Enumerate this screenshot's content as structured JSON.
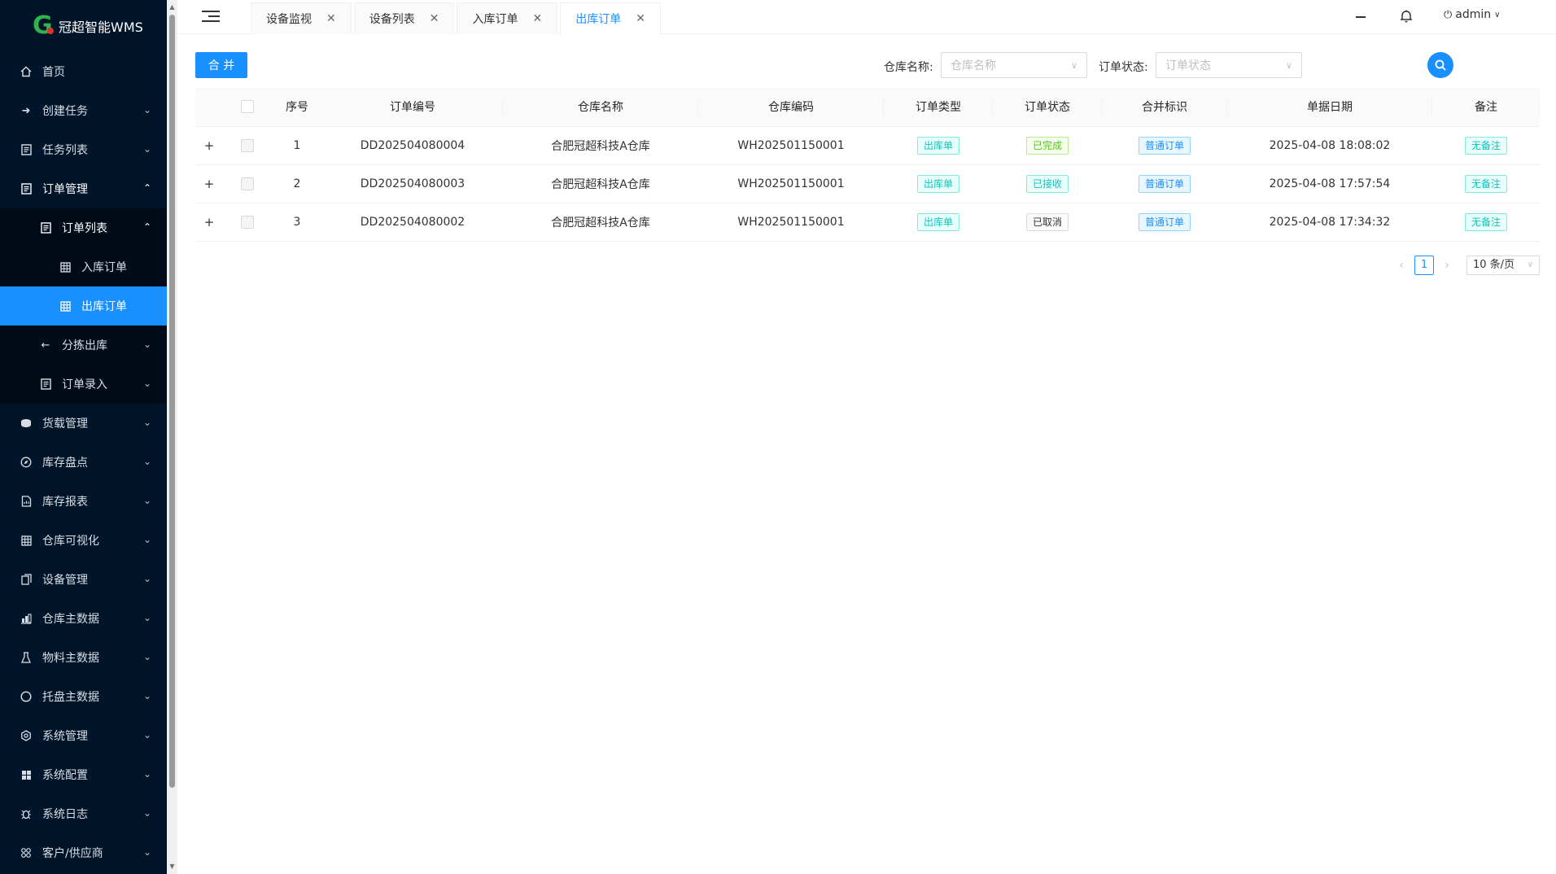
{
  "app": {
    "title": "冠超智能WMS"
  },
  "sidebar": {
    "items": [
      {
        "label": "首页",
        "icon": "home-icon"
      },
      {
        "label": "创建任务",
        "icon": "arrow-right-icon"
      },
      {
        "label": "任务列表",
        "icon": "list-icon"
      },
      {
        "label": "订单管理",
        "icon": "document-icon"
      },
      {
        "label": "订单列表",
        "icon": "document-icon"
      },
      {
        "label": "入库订单",
        "icon": "table-icon"
      },
      {
        "label": "出库订单",
        "icon": "table-icon"
      },
      {
        "label": "分拣出库",
        "icon": "arrow-left-icon"
      },
      {
        "label": "订单录入",
        "icon": "document-icon"
      },
      {
        "label": "货载管理",
        "icon": "database-icon"
      },
      {
        "label": "库存盘点",
        "icon": "compass-icon"
      },
      {
        "label": "库存报表",
        "icon": "report-icon"
      },
      {
        "label": "仓库可视化",
        "icon": "grid-icon"
      },
      {
        "label": "设备管理",
        "icon": "copy-icon"
      },
      {
        "label": "仓库主数据",
        "icon": "bar-chart-icon"
      },
      {
        "label": "物料主数据",
        "icon": "flask-icon"
      },
      {
        "label": "托盘主数据",
        "icon": "circle-icon"
      },
      {
        "label": "系统管理",
        "icon": "gear-icon"
      },
      {
        "label": "系统配置",
        "icon": "appstore-icon"
      },
      {
        "label": "系统日志",
        "icon": "bug-icon"
      },
      {
        "label": "客户/供应商",
        "icon": "team-icon"
      }
    ]
  },
  "header": {
    "tabs": [
      {
        "label": "设备监视"
      },
      {
        "label": "设备列表"
      },
      {
        "label": "入库订单"
      },
      {
        "label": "出库订单"
      }
    ],
    "user": "admin"
  },
  "toolbar": {
    "merge_label": "合 并",
    "warehouse_label": "仓库名称:",
    "warehouse_placeholder": "仓库名称",
    "status_label": "订单状态:",
    "status_placeholder": "订单状态"
  },
  "table": {
    "columns": [
      "序号",
      "订单编号",
      "仓库名称",
      "仓库编码",
      "订单类型",
      "订单状态",
      "合并标识",
      "单据日期",
      "备注"
    ],
    "rows": [
      {
        "no": "1",
        "order_no": "DD202504080004",
        "warehouse": "合肥冠超科技A仓库",
        "code": "WH202501150001",
        "type": "出库单",
        "status": "已完成",
        "status_color": "green",
        "merge": "普通订单",
        "date": "2025-04-08 18:08:02",
        "remark": "无备注"
      },
      {
        "no": "2",
        "order_no": "DD202504080003",
        "warehouse": "合肥冠超科技A仓库",
        "code": "WH202501150001",
        "type": "出库单",
        "status": "已接收",
        "status_color": "cyan",
        "merge": "普通订单",
        "date": "2025-04-08 17:57:54",
        "remark": "无备注"
      },
      {
        "no": "3",
        "order_no": "DD202504080002",
        "warehouse": "合肥冠超科技A仓库",
        "code": "WH202501150001",
        "type": "出库单",
        "status": "已取消",
        "status_color": "gray",
        "merge": "普通订单",
        "date": "2025-04-08 17:34:32",
        "remark": "无备注"
      }
    ]
  },
  "pagination": {
    "current": "1",
    "page_size": "10 条/页"
  }
}
